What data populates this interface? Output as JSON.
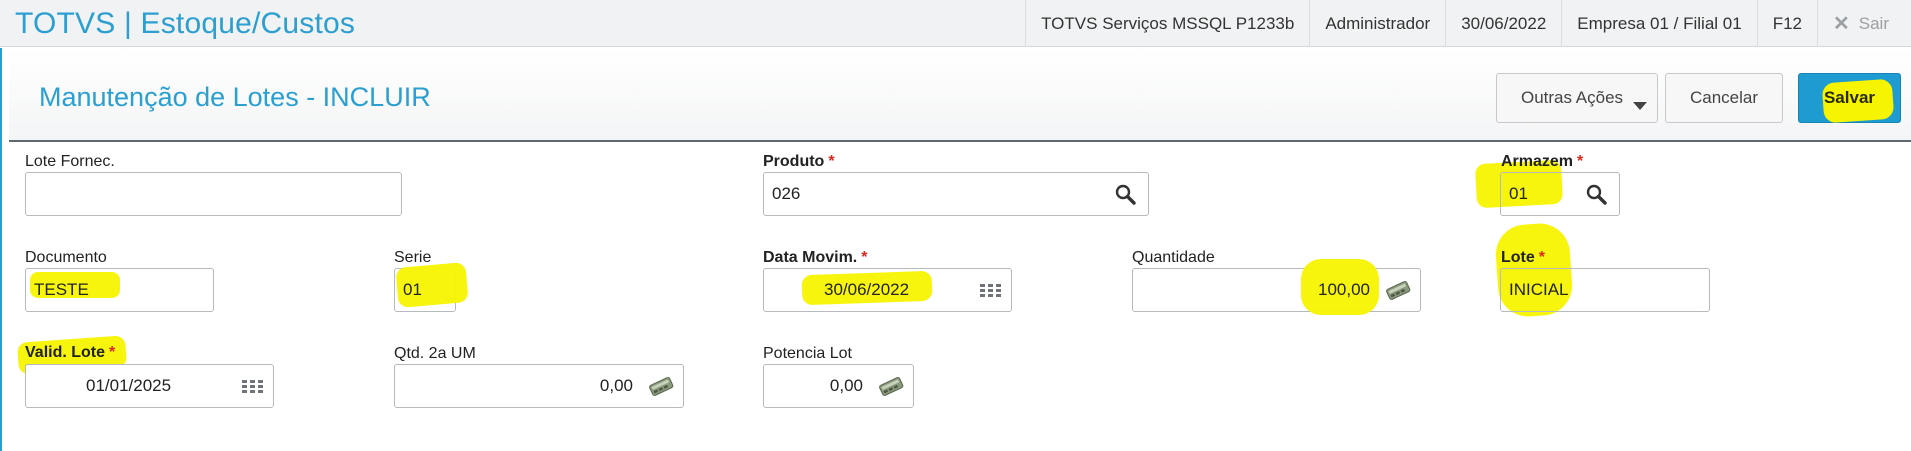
{
  "app": {
    "title": "TOTVS | Estoque/Custos"
  },
  "topbar": {
    "server": "TOTVS Serviços MSSQL P1233b",
    "user": "Administrador",
    "date": "30/06/2022",
    "company": "Empresa 01 / Filial 01",
    "shortcut": "F12",
    "logout_label": "Sair"
  },
  "header": {
    "page_title": "Manutenção de Lotes - INCLUIR",
    "other_actions_label": "Outras Ações",
    "cancel_label": "Cancelar",
    "save_label": "Salvar"
  },
  "fields": {
    "lote_fornec": {
      "label": "Lote Fornec.",
      "value": ""
    },
    "produto": {
      "label": "Produto",
      "value": "026",
      "required": "*"
    },
    "armazem": {
      "label": "Armazem",
      "value": "01",
      "required": "*"
    },
    "documento": {
      "label": "Documento",
      "value": "TESTE"
    },
    "serie": {
      "label": "Serie",
      "value": "01"
    },
    "data_movim": {
      "label": "Data Movim.",
      "value": "30/06/2022",
      "required": "*"
    },
    "quantidade": {
      "label": "Quantidade",
      "value": "100,00"
    },
    "lote": {
      "label": "Lote",
      "value": "INICIAL",
      "required": "*"
    },
    "valid_lote": {
      "label": "Valid. Lote",
      "value": "01/01/2025",
      "required": "*"
    },
    "qtd_2a_um": {
      "label": "Qtd. 2a UM",
      "value": "0,00"
    },
    "potencia_lot": {
      "label": "Potencia Lot",
      "value": "0,00"
    }
  },
  "colors": {
    "accent": "#2a9fd0",
    "required": "#e0261b",
    "highlight": "#f7f400"
  }
}
